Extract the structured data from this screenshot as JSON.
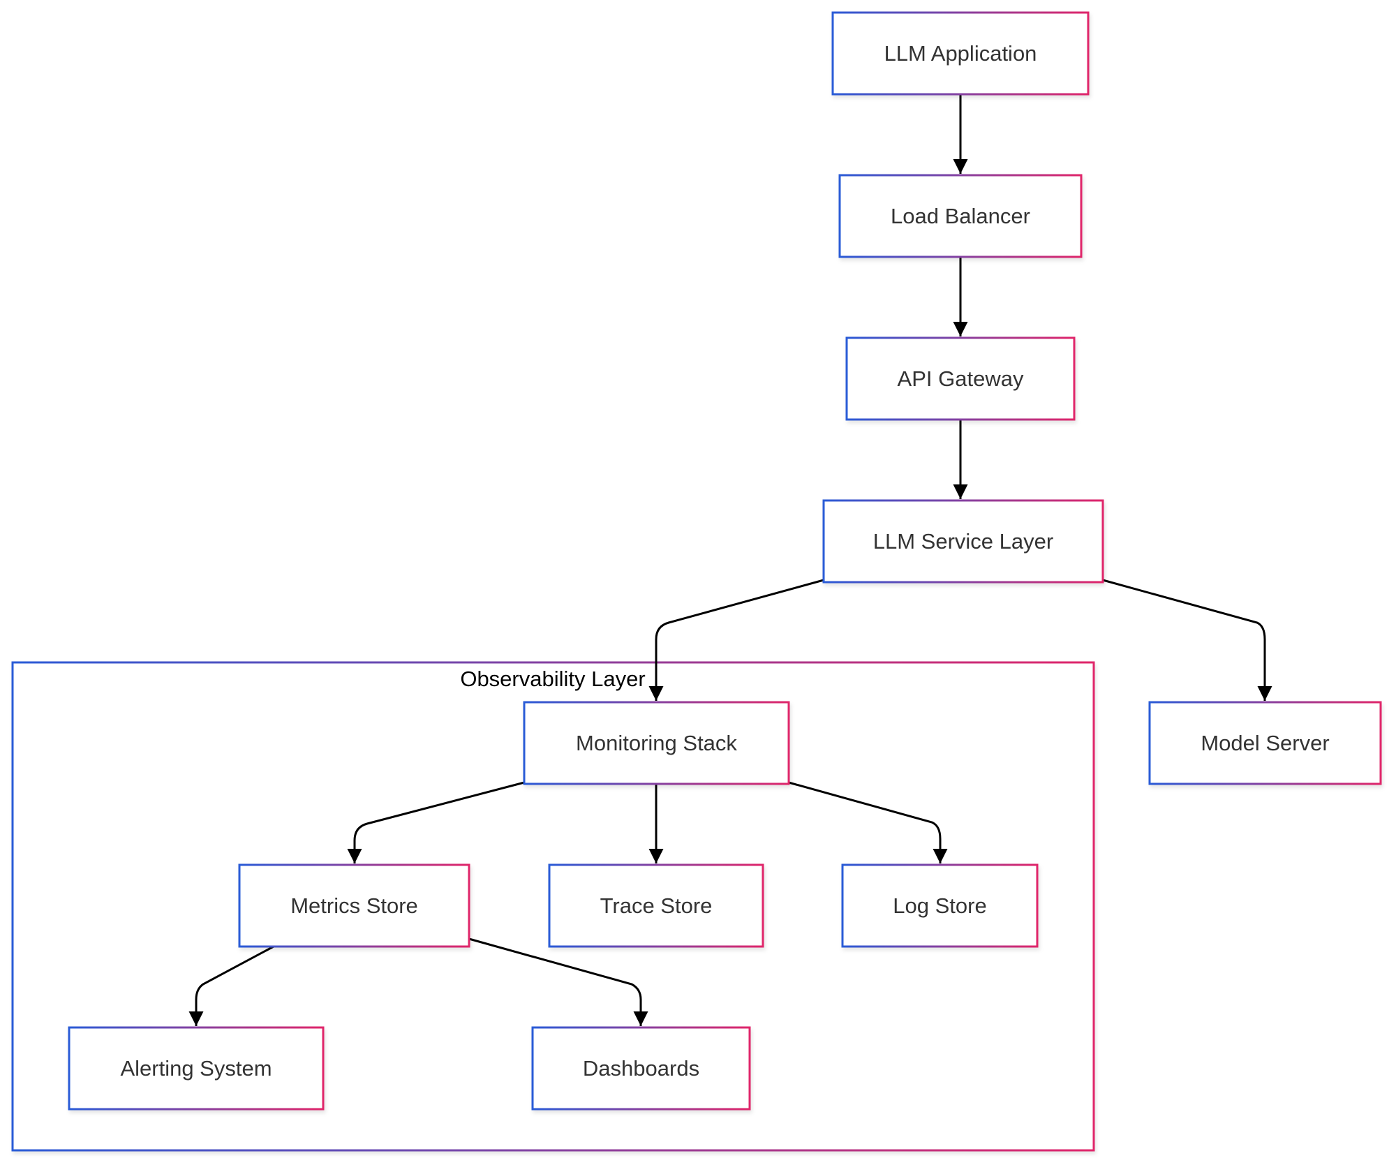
{
  "diagram": {
    "type": "flowchart",
    "colors": {
      "border_gradient_start": "#2a5bd7",
      "border_gradient_end": "#e0266a",
      "text": "#333333",
      "edge": "#000000"
    },
    "cluster": {
      "id": "observability",
      "label": "Observability Layer"
    },
    "nodes": [
      {
        "id": "app",
        "label": "LLM Application"
      },
      {
        "id": "lb",
        "label": "Load Balancer"
      },
      {
        "id": "gw",
        "label": "API Gateway"
      },
      {
        "id": "svc",
        "label": "LLM Service Layer"
      },
      {
        "id": "mon",
        "label": "Monitoring Stack",
        "cluster": "observability"
      },
      {
        "id": "model",
        "label": "Model Server"
      },
      {
        "id": "metrics",
        "label": "Metrics Store",
        "cluster": "observability"
      },
      {
        "id": "trace",
        "label": "Trace Store",
        "cluster": "observability"
      },
      {
        "id": "log",
        "label": "Log Store",
        "cluster": "observability"
      },
      {
        "id": "alert",
        "label": "Alerting System",
        "cluster": "observability"
      },
      {
        "id": "dash",
        "label": "Dashboards",
        "cluster": "observability"
      }
    ],
    "edges": [
      {
        "from": "app",
        "to": "lb"
      },
      {
        "from": "lb",
        "to": "gw"
      },
      {
        "from": "gw",
        "to": "svc"
      },
      {
        "from": "svc",
        "to": "mon"
      },
      {
        "from": "svc",
        "to": "model"
      },
      {
        "from": "mon",
        "to": "metrics"
      },
      {
        "from": "mon",
        "to": "trace"
      },
      {
        "from": "mon",
        "to": "log"
      },
      {
        "from": "metrics",
        "to": "alert"
      },
      {
        "from": "metrics",
        "to": "dash"
      }
    ]
  }
}
